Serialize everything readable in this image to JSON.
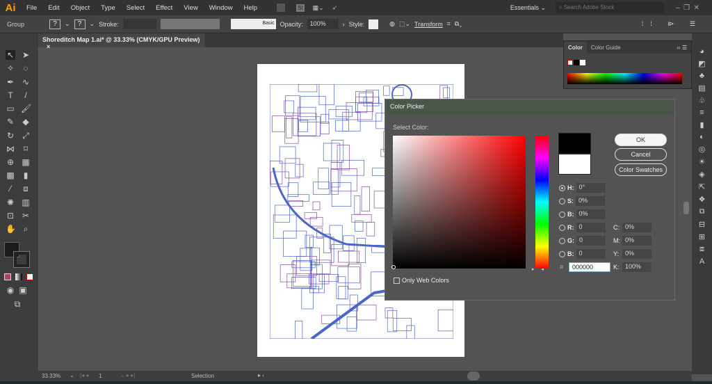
{
  "menubar": {
    "logo": "Ai",
    "items": [
      "File",
      "Edit",
      "Object",
      "Type",
      "Select",
      "Effect",
      "View",
      "Window",
      "Help"
    ],
    "workspace": "Essentials",
    "search_placeholder": "Search Adobe Stock"
  },
  "controlbar": {
    "selection": "Group",
    "stroke_label": "Stroke:",
    "brush": "Basic",
    "opacity_label": "Opacity:",
    "opacity": "100%",
    "style_label": "Style:",
    "transform": "Transform"
  },
  "document_tab": {
    "title": "Shoreditch Map 1.ai* @ 33.33% (CMYK/GPU Preview)",
    "close": "×"
  },
  "color_panel": {
    "tabs": [
      "Color",
      "Color Guide"
    ]
  },
  "color_picker": {
    "title": "Color Picker",
    "select_label": "Select Color:",
    "ok": "OK",
    "cancel": "Cancel",
    "swatches": "Color Swatches",
    "only_web": "Only Web Colors",
    "fields": {
      "H": "0°",
      "S": "0%",
      "B": "0%",
      "R": "0",
      "G": "0",
      "B2": "0",
      "C": "0%",
      "M": "0%",
      "Y": "0%",
      "K": "100%",
      "hex": "000000"
    },
    "hue_color": "#ff0000",
    "new_color": "#000000",
    "old_color": "#ffffff"
  },
  "status": {
    "zoom": "33.33%",
    "page": "1",
    "tool": "Selection"
  }
}
